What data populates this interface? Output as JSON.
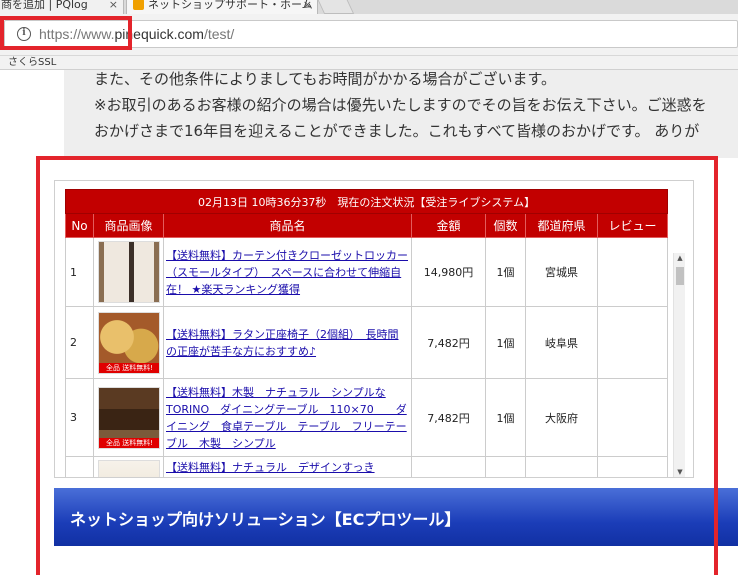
{
  "browser": {
    "tabs": [
      {
        "label": "商を追加 | PQlog"
      },
      {
        "label": "ネットショップサポート・ホーム"
      }
    ],
    "url_prefix": "https://www.",
    "url_host": "pinequick.com",
    "url_path": "/test/",
    "bookmarks": [
      "さくらSSL"
    ]
  },
  "notice": {
    "line1": "また、その他条件によりましてもお時間がかかる場合がございます。",
    "line2": "※お取引のあるお客様の紹介の場合は優先いたしますのでその旨をお伝え下さい。ご迷惑を",
    "line3": "おかげさまで16年目を迎えることができました。これもすべて皆様のおかげです。 ありが"
  },
  "widget": {
    "title": "02月13日 10時36分37秒　現在の注文状況【受注ライブシステム】",
    "headers": [
      "No",
      "商品画像",
      "商品名",
      "金額",
      "個数",
      "都道府県",
      "レビュー"
    ],
    "rows": [
      {
        "no": "1",
        "name": "【送料無料】カーテン付きクローゼットロッカー（スモールタイプ）　スペースに合わせて伸縮自在！ ★楽天ランキング獲得",
        "price": "14,980円",
        "qty": "1個",
        "pref": "宮城県",
        "review": "",
        "thumb": "thumb1",
        "badge": ""
      },
      {
        "no": "2",
        "name": "【送料無料】ラタン正座椅子（2個組）　長時間の正座が苦手な方におすすめ♪",
        "price": "7,482円",
        "qty": "1個",
        "pref": "岐阜県",
        "review": "",
        "thumb": "thumb2",
        "badge": "全品 送料無料!"
      },
      {
        "no": "3",
        "name": "【送料無料】木製　ナチュラル　シンプルなTORINO　ダイニングテーブル　110×70　　ダイニング　食卓テーブル　テーブル　フリーテーブル　木製　シンプル",
        "price": "7,482円",
        "qty": "1個",
        "pref": "大阪府",
        "review": "",
        "thumb": "thumb3",
        "badge": "全品 送料無料!"
      },
      {
        "no": "",
        "name": "【送料無料】ナチュラル　デザインすっき",
        "price": "",
        "qty": "",
        "pref": "",
        "review": "",
        "thumb": "thumb4",
        "badge": ""
      }
    ]
  },
  "banner": {
    "label": "ネットショップ向けソリューション【ECプロツール】"
  },
  "colors": {
    "accent_red": "#c20000",
    "highlight_red": "#e3242b",
    "banner_blue": "#1b3db8"
  }
}
